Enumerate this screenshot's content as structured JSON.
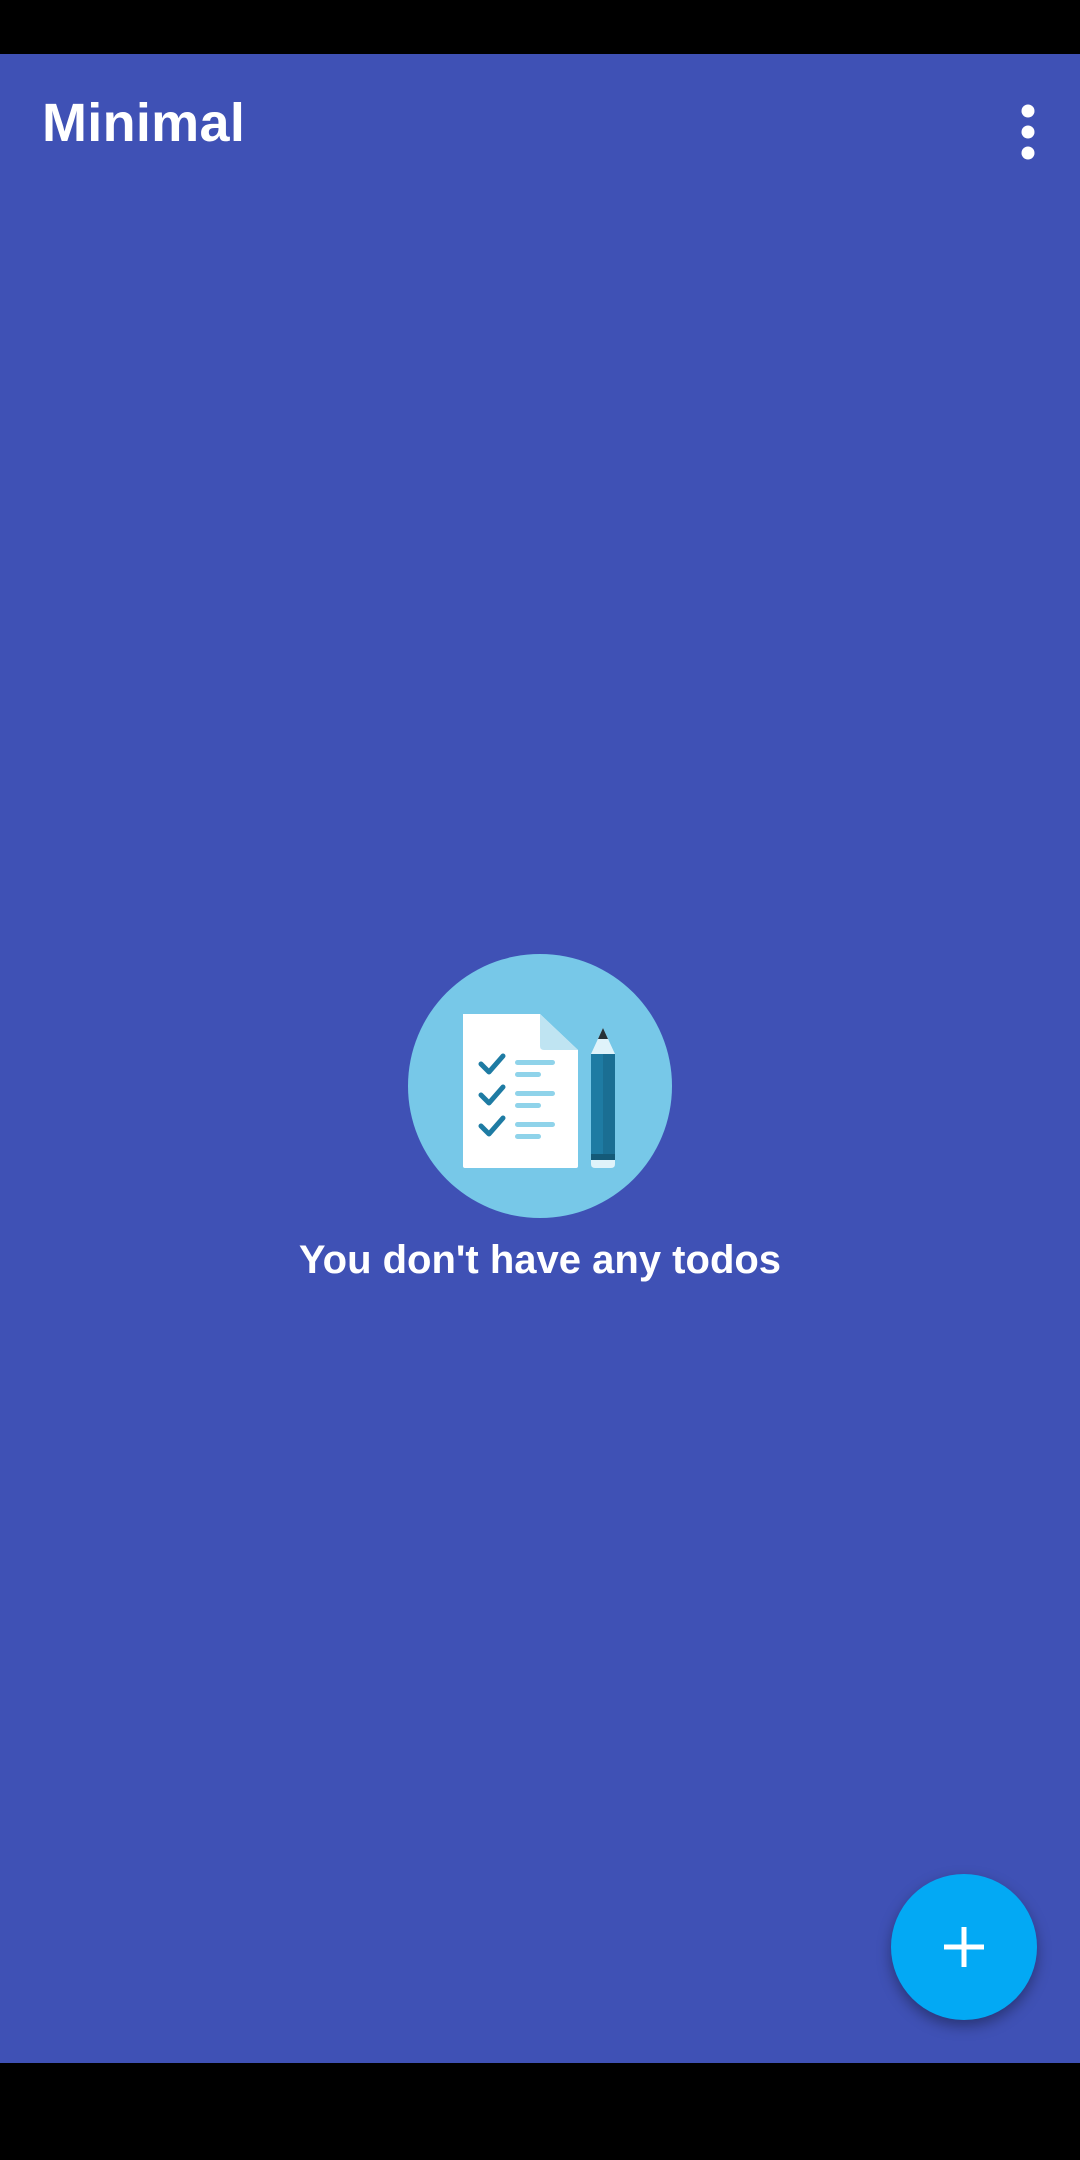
{
  "app": {
    "title": "Minimal"
  },
  "toolbar": {
    "overflow_icon": "more-vert-icon"
  },
  "empty_state": {
    "illustration_icon": "checklist-with-pencil-icon",
    "message": "You don't have any todos"
  },
  "fab": {
    "icon": "plus-icon"
  },
  "colors": {
    "primary": "#3F51B5",
    "accent": "#03A9F4",
    "illustration_circle": "#77C8E8",
    "text_on_primary": "#FFFFFF"
  }
}
